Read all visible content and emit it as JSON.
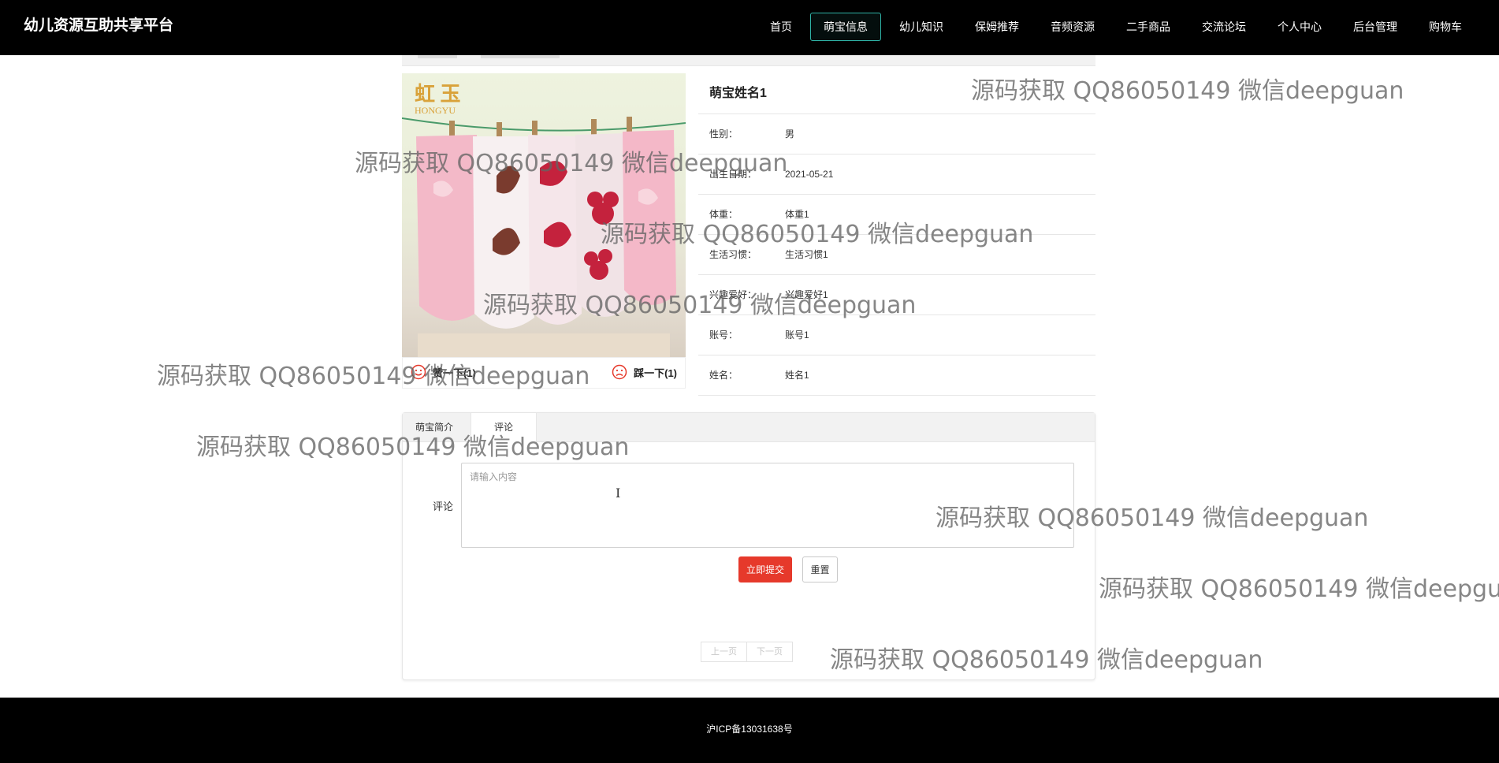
{
  "app": {
    "brand": "幼儿资源互助共享平台"
  },
  "nav": {
    "items": [
      "首页",
      "萌宝信息",
      "幼儿知识",
      "保姆推荐",
      "音频资源",
      "二手商品",
      "交流论坛",
      "个人中心",
      "后台管理",
      "购物车"
    ],
    "active": "萌宝信息"
  },
  "photo": {
    "logo": "虹 玉",
    "logo_sub": "HONGYU"
  },
  "vote": {
    "like_label": "赞一下(1)",
    "dislike_label": "踩一下(1)"
  },
  "detail": {
    "title": "萌宝姓名1",
    "fields": [
      {
        "label": "性别：",
        "value": "男"
      },
      {
        "label": "出生日期：",
        "value": "2021-05-21"
      },
      {
        "label": "体重：",
        "value": "体重1"
      },
      {
        "label": "生活习惯：",
        "value": "生活习惯1"
      },
      {
        "label": "兴趣爱好：",
        "value": "兴趣爱好1"
      },
      {
        "label": "账号：",
        "value": "账号1"
      },
      {
        "label": "姓名：",
        "value": "姓名1"
      }
    ]
  },
  "tabs": {
    "intro": "萌宝简介",
    "comment": "评论"
  },
  "comment": {
    "label": "评论",
    "placeholder": "请输入内容",
    "submit": "立即提交",
    "reset": "重置"
  },
  "pager": {
    "prev": "上一页",
    "next": "下一页"
  },
  "footer": {
    "icp": "沪ICP备13031638号"
  },
  "watermark": "源码获取 QQ86050149 微信deepguan",
  "colors": {
    "accent": "#2fb3a6",
    "submit": "#e6392b",
    "topbar": "#000000"
  }
}
